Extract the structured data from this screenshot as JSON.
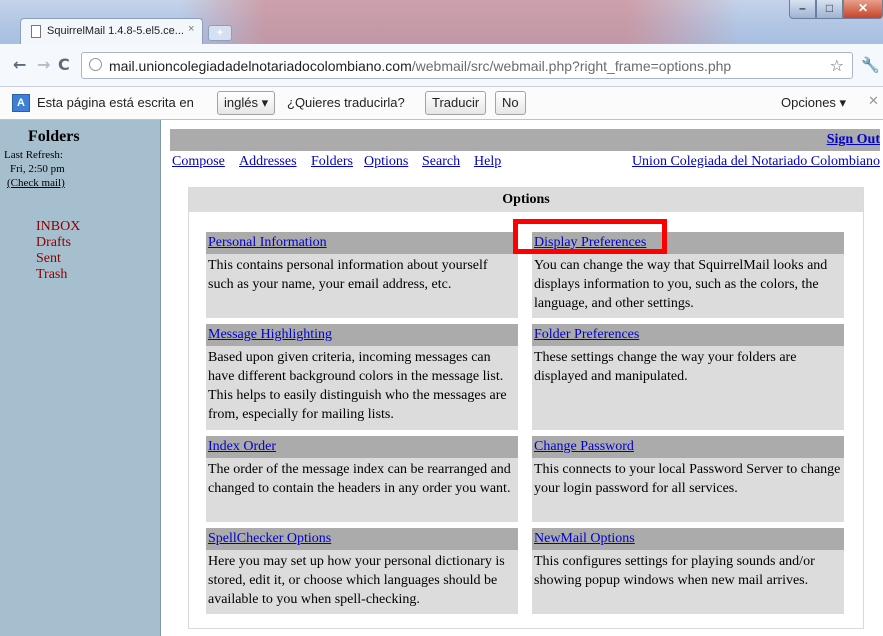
{
  "browser": {
    "tab_title": "SquirrelMail 1.4.8-5.el5.ce...",
    "tab_close": "×",
    "url_host": "mail.unioncolegiadadelnotariadocolombiano.com",
    "url_rest": "/webmail/src/webmail.php?right_frame=options.php"
  },
  "translate_bar": {
    "message": "Esta página está escrita en",
    "language": "inglés ▾",
    "question": "¿Quieres traducirla?",
    "translate_button": "Traducir",
    "no_button": "No",
    "options_button": "Opciones ▾"
  },
  "sidebar": {
    "heading": "Folders",
    "last_refresh_label": "Last Refresh:",
    "last_refresh_time": "Fri, 2:50 pm",
    "check_mail": "(Check mail)",
    "folders": [
      "INBOX",
      "Drafts",
      "Sent",
      "Trash"
    ]
  },
  "header": {
    "sign_out": "Sign Out",
    "nav": [
      "Compose",
      "Addresses",
      "Folders",
      "Options",
      "Search",
      "Help"
    ],
    "org_name": "Union Colegiada del Notariado Colombiano"
  },
  "options": {
    "heading": "Options",
    "items": [
      {
        "title": "Personal Information",
        "description": "This contains personal information about yourself such as your name, your email address, etc."
      },
      {
        "title": "Display Preferences",
        "description": "You can change the way that SquirrelMail looks and displays information to you, such as the colors, the language, and other settings."
      },
      {
        "title": "Message Highlighting",
        "description": "Based upon given criteria, incoming messages can have different background colors in the message list. This helps to easily distinguish who the messages are from, especially for mailing lists."
      },
      {
        "title": "Folder Preferences",
        "description": "These settings change the way your folders are displayed and manipulated."
      },
      {
        "title": "Index Order",
        "description": "The order of the message index can be rearranged and changed to contain the headers in any order you want."
      },
      {
        "title": "Change Password",
        "description": "This connects to your local Password Server to change your login password for all services."
      },
      {
        "title": "SpellChecker Options",
        "description": "Here you may set up how your personal dictionary is stored, edit it, or choose which languages should be available to you when spell-checking."
      },
      {
        "title": "NewMail Options",
        "description": "This configures settings for playing sounds and/or showing popup windows when new mail arrives."
      }
    ]
  },
  "colors": {
    "sidebar_bg": "#a5bfcf",
    "folder_link": "#8b0000",
    "link": "#0000cc",
    "highlight_box": "#ff0000"
  }
}
